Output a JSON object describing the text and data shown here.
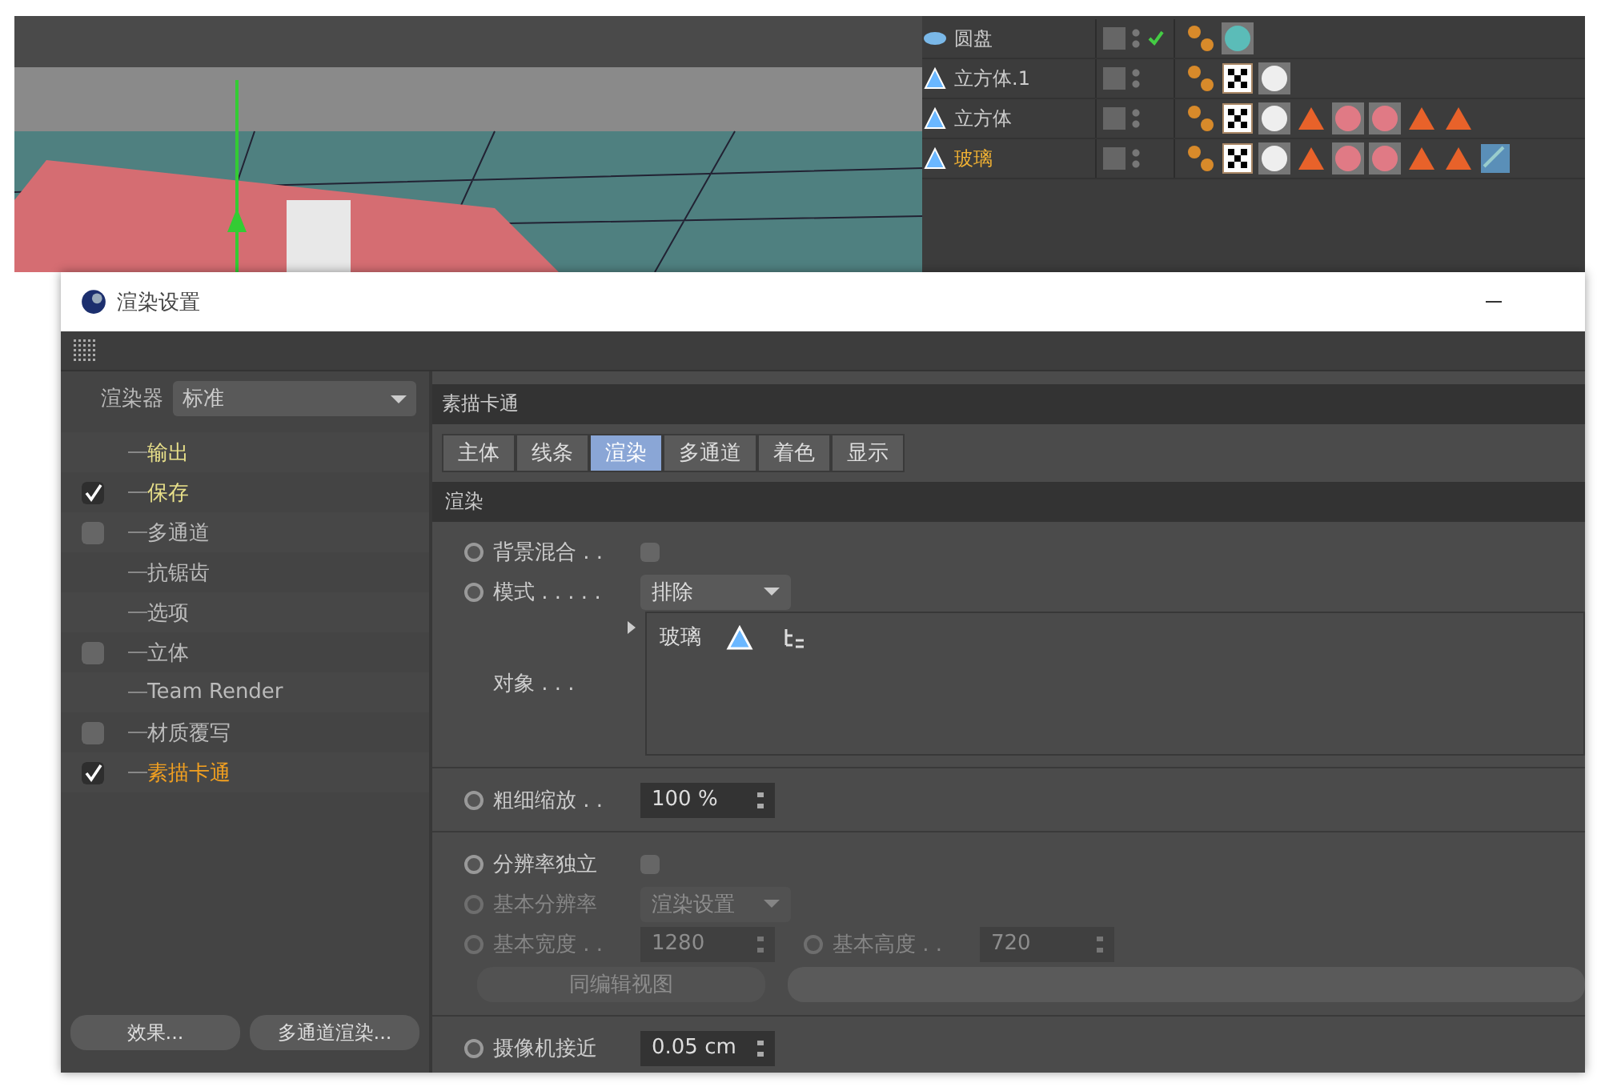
{
  "object_manager": {
    "objects": [
      {
        "name": "圆盘",
        "kind": "disc",
        "enabled_check": true,
        "selected": false,
        "tags": [
          {
            "kind": "phong"
          },
          {
            "kind": "teal-ball"
          }
        ]
      },
      {
        "name": "立方体.1",
        "kind": "poly",
        "enabled_check": false,
        "selected": false,
        "tags": [
          {
            "kind": "phong"
          },
          {
            "kind": "checker"
          },
          {
            "kind": "white-ball"
          }
        ]
      },
      {
        "name": "立方体",
        "kind": "poly",
        "enabled_check": false,
        "selected": false,
        "tags": [
          {
            "kind": "phong"
          },
          {
            "kind": "checker"
          },
          {
            "kind": "white-ball"
          },
          {
            "kind": "cone"
          },
          {
            "kind": "pink-ball"
          },
          {
            "kind": "pink-ball"
          },
          {
            "kind": "cone"
          },
          {
            "kind": "cone"
          }
        ]
      },
      {
        "name": "玻璃",
        "kind": "poly",
        "enabled_check": false,
        "selected": true,
        "tags": [
          {
            "kind": "phong"
          },
          {
            "kind": "checker"
          },
          {
            "kind": "white-ball"
          },
          {
            "kind": "cone"
          },
          {
            "kind": "pink-ball"
          },
          {
            "kind": "pink-ball"
          },
          {
            "kind": "cone"
          },
          {
            "kind": "cone"
          },
          {
            "kind": "glass"
          }
        ]
      }
    ]
  },
  "dialog": {
    "title": "渲染设置",
    "renderer": {
      "label": "渲染器",
      "value": "标准"
    },
    "tree": [
      {
        "label": "输出",
        "kind": "plain",
        "emphasized": true,
        "selected": false
      },
      {
        "label": "保存",
        "kind": "toggle",
        "checked": true,
        "emphasized": true,
        "selected": false
      },
      {
        "label": "多通道",
        "kind": "toggle",
        "checked": false,
        "emphasized": false,
        "selected": false
      },
      {
        "label": "抗锯齿",
        "kind": "plain",
        "emphasized": false,
        "selected": false
      },
      {
        "label": "选项",
        "kind": "plain",
        "emphasized": false,
        "selected": false
      },
      {
        "label": "立体",
        "kind": "toggle",
        "checked": false,
        "emphasized": false,
        "selected": false
      },
      {
        "label": "Team Render",
        "kind": "plain",
        "emphasized": false,
        "selected": false
      },
      {
        "label": "材质覆写",
        "kind": "toggle",
        "checked": false,
        "emphasized": false,
        "selected": false
      },
      {
        "label": "素描卡通",
        "kind": "toggle",
        "checked": true,
        "emphasized": false,
        "selected": true
      }
    ],
    "left_buttons": [
      "效果...",
      "多通道渲染..."
    ],
    "header": "素描卡通",
    "tabs": [
      {
        "label": "主体",
        "selected": false
      },
      {
        "label": "线条",
        "selected": false
      },
      {
        "label": "渲染",
        "selected": true
      },
      {
        "label": "多通道",
        "selected": false
      },
      {
        "label": "着色",
        "selected": false
      },
      {
        "label": "显示",
        "selected": false
      }
    ],
    "section": "渲染",
    "params": [
      {
        "kind": "checkbox",
        "label": "背景混合 . .",
        "checked": false,
        "disabled": false
      },
      {
        "kind": "dropdown",
        "label": "模式 . . . . .",
        "value": "排除",
        "disabled": false
      },
      {
        "kind": "list",
        "label": "对象 . . .",
        "value": "玻璃",
        "disabled": false
      },
      {
        "kind": "divider"
      },
      {
        "kind": "number",
        "label": "粗细缩放 . .",
        "value": "100 %",
        "disabled": false
      },
      {
        "kind": "divider"
      },
      {
        "kind": "checkbox",
        "label": "分辨率独立",
        "checked": false,
        "disabled": false
      },
      {
        "kind": "dropdown",
        "label": "基本分辨率",
        "value": "渲染设置",
        "disabled": true
      },
      {
        "kind": "pair",
        "label": "基本宽度 . .",
        "value": "1280",
        "label2": "基本高度 . .",
        "value2": "720",
        "disabled": true
      },
      {
        "kind": "buttons",
        "label": "同编辑视图",
        "disabled": true
      },
      {
        "kind": "divider"
      },
      {
        "kind": "number",
        "label": "摄像机接近",
        "value": "0.05 cm",
        "disabled": false
      }
    ]
  }
}
